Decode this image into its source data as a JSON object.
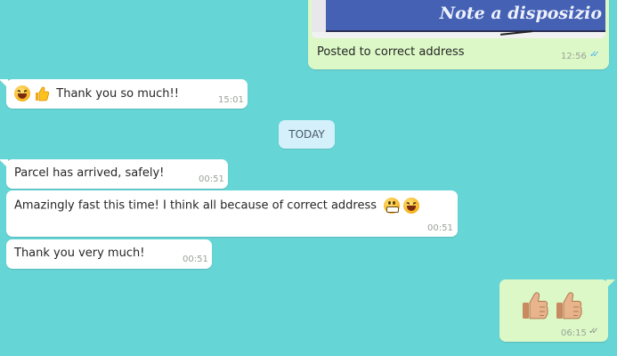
{
  "messages": {
    "photo_out": {
      "photo_text": "Note a disposizio",
      "caption": "Posted to correct address",
      "time": "12:56",
      "ticks": "✓✓"
    },
    "thanks_in": {
      "text": "Thank you so much!!",
      "time": "15:01"
    },
    "date_separator": "TODAY",
    "arrived_in": {
      "text": "Parcel has arrived, safely!",
      "time": "00:51"
    },
    "fast_in": {
      "text": "Amazingly fast this time! I think all because of correct address",
      "time": "00:51"
    },
    "thanks_very_in": {
      "text": "Thank you very much!",
      "time": "00:51"
    },
    "thumbs_out": {
      "time": "06:15",
      "ticks": "✓✓"
    }
  },
  "icons": {
    "laughing_face": "laughing-face-emoji",
    "grinning_face": "grimacing-face-emoji",
    "thumbs_up": "thumbs-up-emoji",
    "read_receipt": "double-check-icon"
  },
  "colors": {
    "background": "#66d5d6",
    "incoming_bubble": "#ffffff",
    "outgoing_bubble": "#dcf8c6",
    "read_ticks": "#4fb3f6",
    "delivered_ticks": "#8a958a",
    "date_chip": "#d4f0fb"
  }
}
